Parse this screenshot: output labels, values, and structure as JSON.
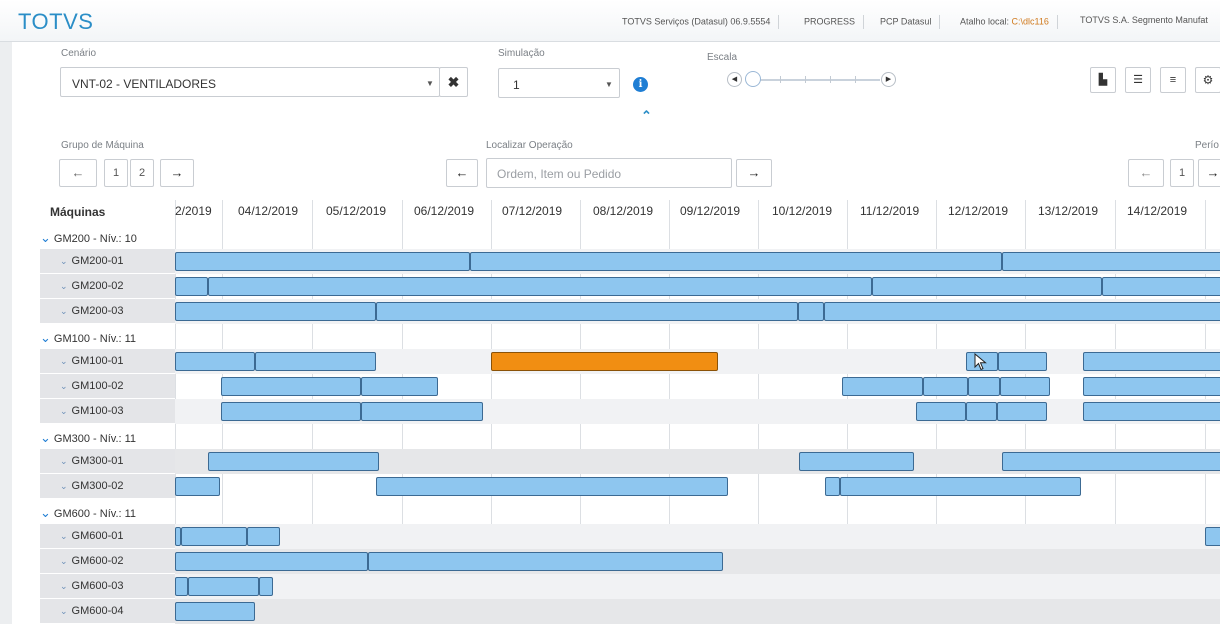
{
  "header": {
    "logo": "TOTVS",
    "info": [
      "TOTVS Serviços (Datasul) 06.9.5554",
      "PROGRESS",
      "PCP Datasul"
    ],
    "atalho_label": "Atalho local: ",
    "atalho_value": "C:\\dlc116",
    "company": "TOTVS S.A. Segmento Manufat"
  },
  "filters": {
    "cenario_label": "Cenário",
    "cenario_value": "VNT-02 - VENTILADORES",
    "simulacao_label": "Simulação",
    "simulacao_value": "1",
    "escala_label": "Escala",
    "grupo_label": "Grupo de Máquina",
    "grupo_pages": [
      "1",
      "2"
    ],
    "localizar_label": "Localizar Operação",
    "localizar_placeholder": "Ordem, Item ou Pedido",
    "periodo_label": "Perío",
    "periodo_page": "1"
  },
  "gantt": {
    "machines_header": "Máquinas",
    "dates": [
      "2/2019",
      "04/12/2019",
      "05/12/2019",
      "06/12/2019",
      "07/12/2019",
      "08/12/2019",
      "09/12/2019",
      "10/12/2019",
      "11/12/2019",
      "12/12/2019",
      "13/12/2019",
      "14/12/2019"
    ],
    "rows": [
      {
        "type": "group",
        "label": "GM200 - Nív.: 10"
      },
      {
        "type": "machine",
        "label": "GM200-01"
      },
      {
        "type": "machine",
        "label": "GM200-02"
      },
      {
        "type": "machine",
        "label": "GM200-03"
      },
      {
        "type": "group",
        "label": "GM100 - Nív.: 11"
      },
      {
        "type": "machine",
        "label": "GM100-01"
      },
      {
        "type": "machine",
        "label": "GM100-02"
      },
      {
        "type": "machine",
        "label": "GM100-03"
      },
      {
        "type": "group",
        "label": "GM300 - Nív.: 11"
      },
      {
        "type": "machine",
        "label": "GM300-01"
      },
      {
        "type": "machine",
        "label": "GM300-02"
      },
      {
        "type": "group",
        "label": "GM600 - Nív.: 11"
      },
      {
        "type": "machine",
        "label": "GM600-01"
      },
      {
        "type": "machine",
        "label": "GM600-02"
      },
      {
        "type": "machine",
        "label": "GM600-03"
      },
      {
        "type": "machine",
        "label": "GM600-04"
      }
    ]
  },
  "colors": {
    "brand": "#2b8ec7",
    "bar": "#8ec6ef",
    "bar_selected": "#f18e12"
  }
}
